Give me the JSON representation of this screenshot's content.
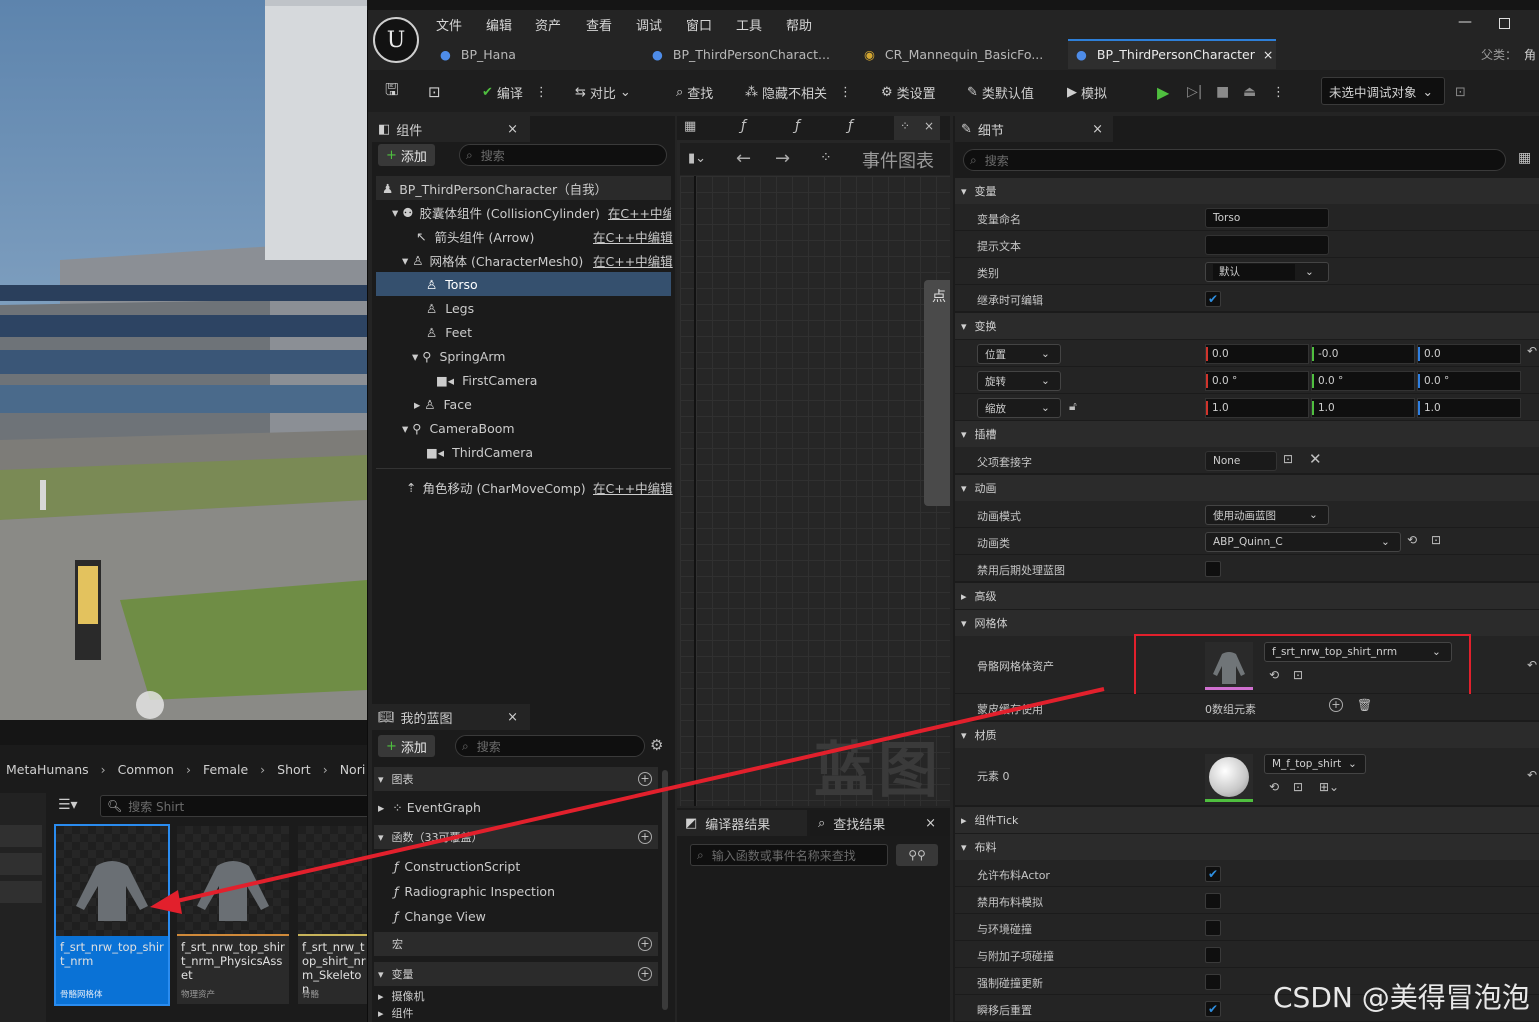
{
  "menu": [
    "文件",
    "编辑",
    "资产",
    "查看",
    "调试",
    "窗口",
    "工具",
    "帮助"
  ],
  "tabs": [
    "BP_Hana",
    "BP_ThirdPersonCharact...",
    "CR_Mannequin_BasicFo...",
    "BP_ThirdPersonCharacter"
  ],
  "parent_label": "父类：",
  "parent_value": "角",
  "toolbar": {
    "compile": "编译",
    "diff": "对比",
    "find": "查找",
    "hide": "隐藏不相关",
    "class_settings": "类设置",
    "class_defaults": "类默认值",
    "simulate": "模拟",
    "debug_target": "未选中调试对象"
  },
  "components": {
    "title": "组件",
    "add": "添加",
    "search_placeholder": "搜索",
    "root": "BP_ThirdPersonCharacter（自我）",
    "capsule": "胶囊体组件 (CollisionCylinder)",
    "capsule_edit": "在C++中编辑",
    "arrow": "箭头组件 (Arrow)",
    "arrow_edit": "在C++中编辑",
    "mesh": "网格体 (CharacterMesh0)",
    "mesh_edit": "在C++中编辑",
    "items": [
      "Torso",
      "Legs",
      "Feet",
      "SpringArm",
      "FirstCamera",
      "Face",
      "CameraBoom",
      "ThirdCamera"
    ],
    "movement": "角色移动 (CharMoveComp)",
    "movement_edit": "在C++中编辑"
  },
  "graph": {
    "title": "事件图表",
    "watermark": "蓝图",
    "tab_stub": "点"
  },
  "myblueprint": {
    "title": "我的蓝图",
    "add": "添加",
    "search_placeholder": "搜索",
    "graphs": "图表",
    "eventgraph": "EventGraph",
    "functions": "函数（33可覆盖）",
    "fn_items": [
      "ConstructionScript",
      "Radiographic Inspection",
      "Change View"
    ],
    "macros": "宏",
    "variables": "变量",
    "var_items": [
      "摄像机",
      "组件"
    ]
  },
  "compiler": {
    "tab1": "编译器结果",
    "tab2": "查找结果",
    "search_placeholder": "输入函数或事件名称来查找"
  },
  "details": {
    "title": "细节",
    "search_placeholder": "搜索",
    "cat_variable": "变量",
    "var_name_label": "变量命名",
    "var_name": "Torso",
    "tooltip_label": "提示文本",
    "category_label": "类别",
    "category_value": "默认",
    "editable_label": "继承时可编辑",
    "cat_transform": "变换",
    "loc": "位置",
    "rot": "旋转",
    "scale": "缩放",
    "loc_vals": [
      "0.0",
      "-0.0",
      "0.0"
    ],
    "rot_vals": [
      "0.0 °",
      "0.0 °",
      "0.0 °"
    ],
    "scale_vals": [
      "1.0",
      "1.0",
      "1.0"
    ],
    "cat_socket": "插槽",
    "parent_socket_label": "父项套接字",
    "parent_socket": "None",
    "cat_anim": "动画",
    "anim_mode_label": "动画模式",
    "anim_mode": "使用动画蓝图",
    "anim_class_label": "动画类",
    "anim_class": "ABP_Quinn_C",
    "disable_post_label": "禁用后期处理蓝图",
    "cat_advanced": "高级",
    "cat_mesh": "网格体",
    "skm_label": "骨骼网格体资产",
    "skm_value": "f_srt_nrw_top_shirt_nrm",
    "skin_cache_label": "蒙皮缓存使用",
    "skin_cache_value": "0数组元素",
    "cat_material": "材质",
    "element0_label": "元素 0",
    "element0_value": "M_f_top_shirt",
    "cat_tick": "组件Tick",
    "cat_cloth": "布料",
    "cloth_items": [
      "允许布料Actor",
      "禁用布料模拟",
      "与环境碰撞",
      "与附加子项碰撞",
      "强制碰撞更新",
      "瞬移后重置"
    ]
  },
  "content_browser": {
    "breadcrumb": [
      "MetaHumans",
      "Common",
      "Female",
      "Short",
      "Nori"
    ],
    "search_placeholder": "搜索 Shirt",
    "assets": [
      {
        "name": "f_srt_nrw_top_shirt_nrm",
        "type": "骨骼网格体"
      },
      {
        "name": "f_srt_nrw_top_shirt_nrm_PhysicsAsset",
        "type": "物理资产"
      },
      {
        "name": "f_srt_nrw_top_shirt_nrm_Skeleton",
        "type": "骨骼"
      }
    ]
  },
  "watermark": "CSDN @美得冒泡泡"
}
